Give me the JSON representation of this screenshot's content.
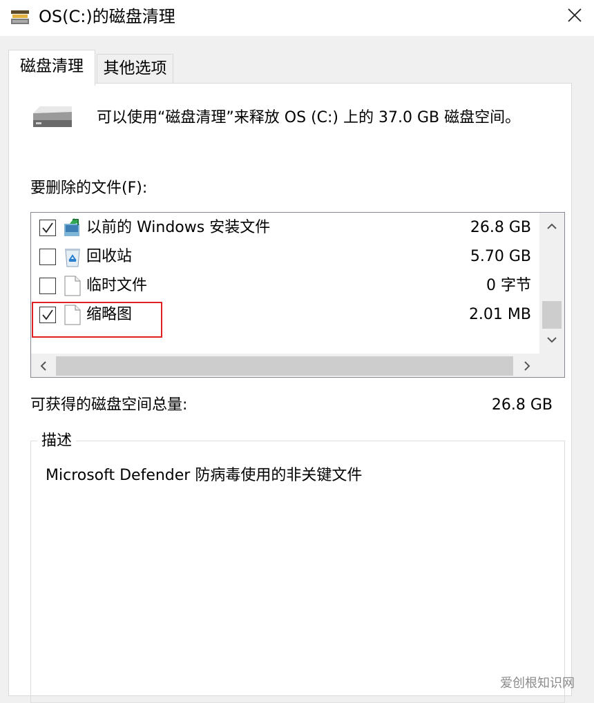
{
  "window": {
    "title": "OS(C:)的磁盘清理",
    "icon": "disk-cleanup-icon",
    "close_icon": "close-icon"
  },
  "tabs": [
    {
      "label": "磁盘清理",
      "active": true
    },
    {
      "label": "其他选项",
      "active": false
    }
  ],
  "info": {
    "drive_icon": "hard-drive-icon",
    "text": "可以使用“磁盘清理”来释放 OS (C:) 上的 37.0 GB 磁盘空间。"
  },
  "files": {
    "label": "要删除的文件(F):",
    "items": [
      {
        "label": "以前的 Windows 安装文件",
        "size": "26.8 GB",
        "checked": true,
        "icon": "windows-update-icon"
      },
      {
        "label": "回收站",
        "size": "5.70 GB",
        "checked": false,
        "icon": "recycle-bin-icon"
      },
      {
        "label": "临时文件",
        "size": "0 字节",
        "checked": false,
        "icon": "document-icon"
      },
      {
        "label": "缩略图",
        "size": "2.01 MB",
        "checked": true,
        "icon": "document-icon"
      }
    ]
  },
  "total": {
    "label": "可获得的磁盘空间总量:",
    "value": "26.8 GB"
  },
  "description": {
    "legend": "描述",
    "text": "Microsoft Defender 防病毒使用的非关键文件"
  },
  "watermark": "爱创根知识网",
  "colors": {
    "highlight_box": "#e02020",
    "window_bg": "#f0f0f0",
    "panel_bg": "#ffffff",
    "scrollbar_thumb": "#cdcdcd"
  }
}
